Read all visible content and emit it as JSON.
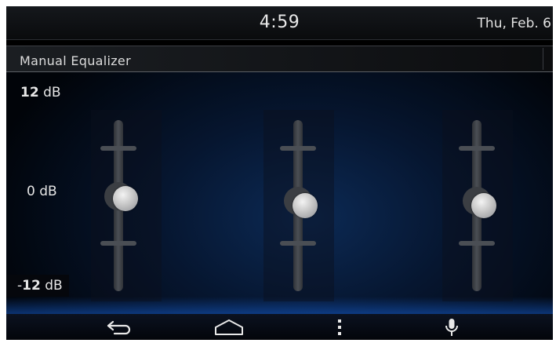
{
  "status_bar": {
    "time": "4:59",
    "date": "Thu, Feb. 6"
  },
  "screen_title": "Manual Equalizer",
  "scale_labels": {
    "top": {
      "number": "12",
      "unit": " dB"
    },
    "middle": "0 dB",
    "bottom": {
      "sign": "-",
      "number": "12",
      "unit": " dB"
    }
  },
  "equalizer": {
    "range_db": [
      -12,
      12
    ],
    "bands": [
      {
        "id": "band-1",
        "value_db": 1
      },
      {
        "id": "band-2",
        "value_db": 0
      },
      {
        "id": "band-3",
        "value_db": 0
      }
    ]
  },
  "navigation": [
    "back-icon",
    "home-icon",
    "menu-icon",
    "microphone-icon"
  ]
}
